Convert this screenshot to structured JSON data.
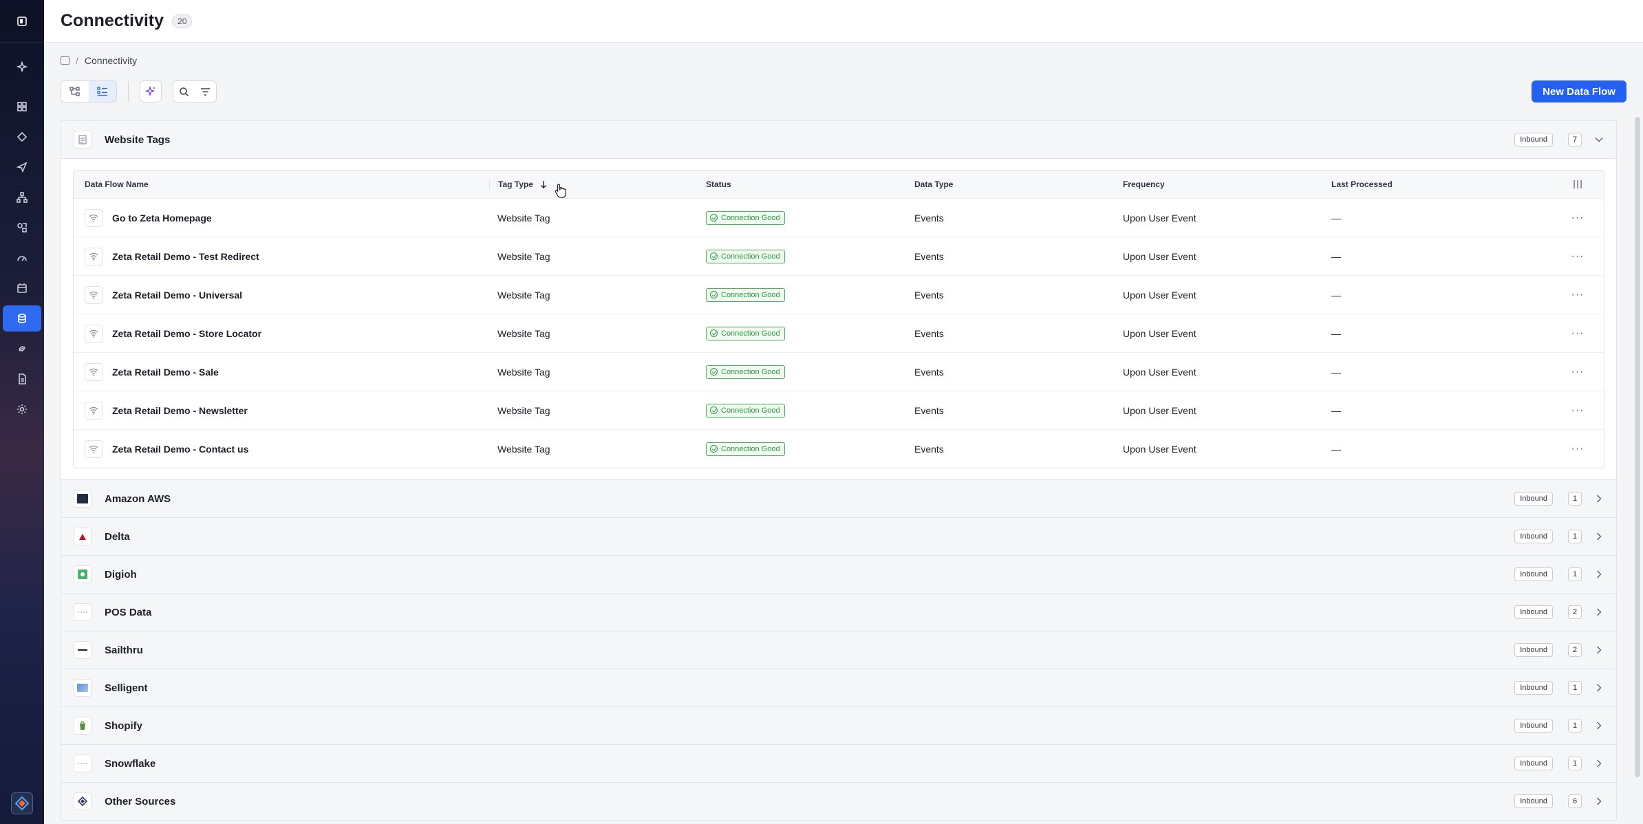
{
  "header": {
    "title": "Connectivity",
    "count": "20"
  },
  "breadcrumb": {
    "current": "Connectivity"
  },
  "toolbar": {
    "new_button": "New Data Flow"
  },
  "table": {
    "columns": [
      "Data Flow Name",
      "Tag Type",
      "Status",
      "Data Type",
      "Frequency",
      "Last Processed"
    ]
  },
  "groups": [
    {
      "name": "Website Tags",
      "direction": "Inbound",
      "count": "7",
      "expanded": true,
      "rows": [
        {
          "name": "Go to Zeta Homepage",
          "tag_type": "Website Tag",
          "status": "Connection Good",
          "data_type": "Events",
          "frequency": "Upon User Event",
          "last_processed": "—"
        },
        {
          "name": "Zeta Retail Demo - Test Redirect",
          "tag_type": "Website Tag",
          "status": "Connection Good",
          "data_type": "Events",
          "frequency": "Upon User Event",
          "last_processed": "—"
        },
        {
          "name": "Zeta Retail Demo - Universal",
          "tag_type": "Website Tag",
          "status": "Connection Good",
          "data_type": "Events",
          "frequency": "Upon User Event",
          "last_processed": "—"
        },
        {
          "name": "Zeta Retail Demo - Store Locator",
          "tag_type": "Website Tag",
          "status": "Connection Good",
          "data_type": "Events",
          "frequency": "Upon User Event",
          "last_processed": "—"
        },
        {
          "name": "Zeta Retail Demo - Sale",
          "tag_type": "Website Tag",
          "status": "Connection Good",
          "data_type": "Events",
          "frequency": "Upon User Event",
          "last_processed": "—"
        },
        {
          "name": "Zeta Retail Demo - Newsletter",
          "tag_type": "Website Tag",
          "status": "Connection Good",
          "data_type": "Events",
          "frequency": "Upon User Event",
          "last_processed": "—"
        },
        {
          "name": "Zeta Retail Demo - Contact us",
          "tag_type": "Website Tag",
          "status": "Connection Good",
          "data_type": "Events",
          "frequency": "Upon User Event",
          "last_processed": "—"
        }
      ]
    },
    {
      "name": "Amazon AWS",
      "direction": "Inbound",
      "count": "1"
    },
    {
      "name": "Delta",
      "direction": "Inbound",
      "count": "1"
    },
    {
      "name": "Digioh",
      "direction": "Inbound",
      "count": "1"
    },
    {
      "name": "POS Data",
      "direction": "Inbound",
      "count": "2"
    },
    {
      "name": "Sailthru",
      "direction": "Inbound",
      "count": "2"
    },
    {
      "name": "Selligent",
      "direction": "Inbound",
      "count": "1"
    },
    {
      "name": "Shopify",
      "direction": "Inbound",
      "count": "1"
    },
    {
      "name": "Snowflake",
      "direction": "Inbound",
      "count": "1"
    },
    {
      "name": "Other Sources",
      "direction": "Inbound",
      "count": "6"
    }
  ],
  "colors": {
    "accent": "#2461f0",
    "status_good": "#2e9a41"
  }
}
